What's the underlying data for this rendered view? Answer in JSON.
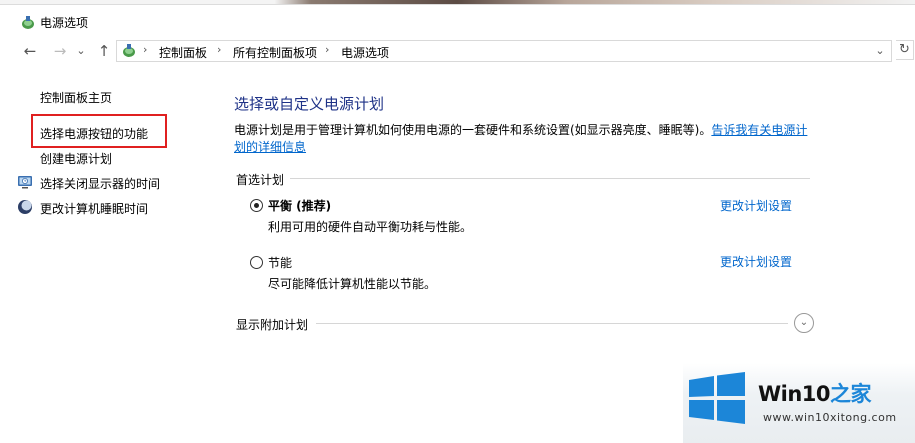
{
  "window": {
    "title": "电源选项"
  },
  "nav": {
    "back_icon": "←",
    "forward_icon": "→",
    "dropdown_icon": "⌄",
    "up_icon": "↑",
    "breadcrumb": [
      "控制面板",
      "所有控制面板项",
      "电源选项"
    ],
    "breadcrumb_sep": "›",
    "addr_dropdown_icon": "⌄",
    "refresh_icon": "↻"
  },
  "sidebar": {
    "items": [
      {
        "label": "控制面板主页"
      },
      {
        "label": "选择电源按钮的功能"
      },
      {
        "label": "创建电源计划"
      },
      {
        "label": "选择关闭显示器的时间"
      },
      {
        "label": "更改计算机睡眠时间"
      }
    ]
  },
  "main": {
    "heading": "选择或自定义电源计划",
    "description": "电源计划是用于管理计算机如何使用电源的一套硬件和系统设置(如显示器亮度、睡眠等)。",
    "description_link": "告诉我有关电源计划的详细信息",
    "preferred_label": "首选计划",
    "plans": [
      {
        "name": "平衡 (推荐)",
        "desc": "利用可用的硬件自动平衡功耗与性能。",
        "link": "更改计划设置",
        "selected": true
      },
      {
        "name": "节能",
        "desc": "尽可能降低计算机性能以节能。",
        "link": "更改计划设置",
        "selected": false
      }
    ],
    "more_plans_label": "显示附加计划",
    "expand_icon": "⌄"
  },
  "watermark": {
    "brand_black": "Win10",
    "brand_blue": "之家",
    "url": "www.win10xitong.com",
    "colors": {
      "logo": "#1c86d8"
    }
  }
}
